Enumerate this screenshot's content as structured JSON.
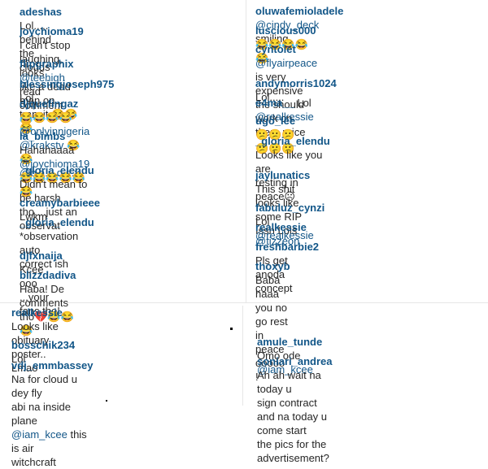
{
  "left_top": [
    {
      "user": "adeshas",
      "text": "Lol..... behind the clouds",
      "emoji": ""
    },
    {
      "user": "joychioma19",
      "text": "I can't stop laughing, looks",
      "text2": "like a dead man on transit",
      "emoji": "😂😂😂"
    },
    {
      "user": "flipgraphix",
      "mention": "@teehigh",
      "text": " read comment",
      "emoji": "😂"
    },
    {
      "user": "blessingjoseph975",
      "text": "Lol",
      "emoji": ""
    },
    {
      "user": "djquefingaz",
      "emoji": "😂😂😂😂",
      "mention": "@onlyinnigeria",
      "mention2": "@krakstv",
      "emoji2": "😂 😂",
      "mention3": "@b.a.u.d.e.x"
    },
    {
      "user": "la_bimbs",
      "text": "Hahahaaaa",
      "mention": "@joychioma19",
      "emoji": "😂😂😂😂😂😂"
    },
    {
      "user": "_gloria_elendu",
      "text": "Didn't mean to be harsh",
      "text2": "tho....just an observat"
    },
    {
      "user": "creamybarbieee",
      "text": "Lwkm"
    },
    {
      "user": "_gloria_elendu",
      "text": "*observation auto",
      "text2": "correct ish"
    },
    {
      "user": "djfxnaija",
      "text": "Kcee ooo ...your fans tho!"
    },
    {
      "user": "blizzdadiva",
      "text": "Haba! De comments",
      "text2": "tho",
      "emoji": "💔😂😂😂"
    }
  ],
  "right_top": [
    {
      "user": "oluwafemioladele",
      "mention": "@cindy_deck",
      "text": " smiling"
    },
    {
      "user": "luscious000",
      "emoji": "😂😂😂😂😂"
    },
    {
      "user": "cyntolet",
      "mention": "@flyairpeace",
      "text": " is very expensive",
      "text2": "the should work on there price"
    },
    {
      "user": "andymorris1024",
      "text": "Lol....."
    },
    {
      "user": "e4ma__",
      "text": "Lol",
      "mention": "@realkessie"
    },
    {
      "user": "ugo_lee",
      "emoji": "😕😕😕😕😕😕"
    },
    {
      "user": "_gloria_elendu",
      "text": "Looks like you are",
      "text2": "resting in peace",
      "emoji": "☹"
    },
    {
      "user": "jaylunatics",
      "text": "This shit looks like some RIP",
      "text2": "Issh Lols"
    },
    {
      "user": "fabuluz_cynzi",
      "text": "Lol",
      "mention": "@realkessie"
    },
    {
      "user": "realkessie",
      "mention": "@tizzeon"
    },
    {
      "user": "freshbarbie2",
      "text": "Pls get anoda concept"
    },
    {
      "user": "thoxyb",
      "text": "Baba haaa you no go rest in",
      "text2": "peace ooooo !"
    }
  ],
  "left_bottom": [
    {
      "user": "realkessie",
      "text": "Looks like obituary poster..",
      "text2": "Lmao"
    },
    {
      "user": "bosschik234",
      "text": "Lol"
    },
    {
      "user": "vdj_emmbassey",
      "text": "Na for cloud u dey fly",
      "text2": "abi na inside plane",
      "mention": "@iam_kcee",
      "text3": " this is air",
      "text4": "witchcraft"
    }
  ],
  "right_bottom": [
    {
      "user": "amule_tunde",
      "text": "Omo ode",
      "mention": "@iam_kcee"
    },
    {
      "user": "soniari_andrea",
      "text": "Ah ah wait na today u",
      "text2": "sign contract and na today u come start",
      "text3": "the pics for the advertisement?"
    }
  ]
}
